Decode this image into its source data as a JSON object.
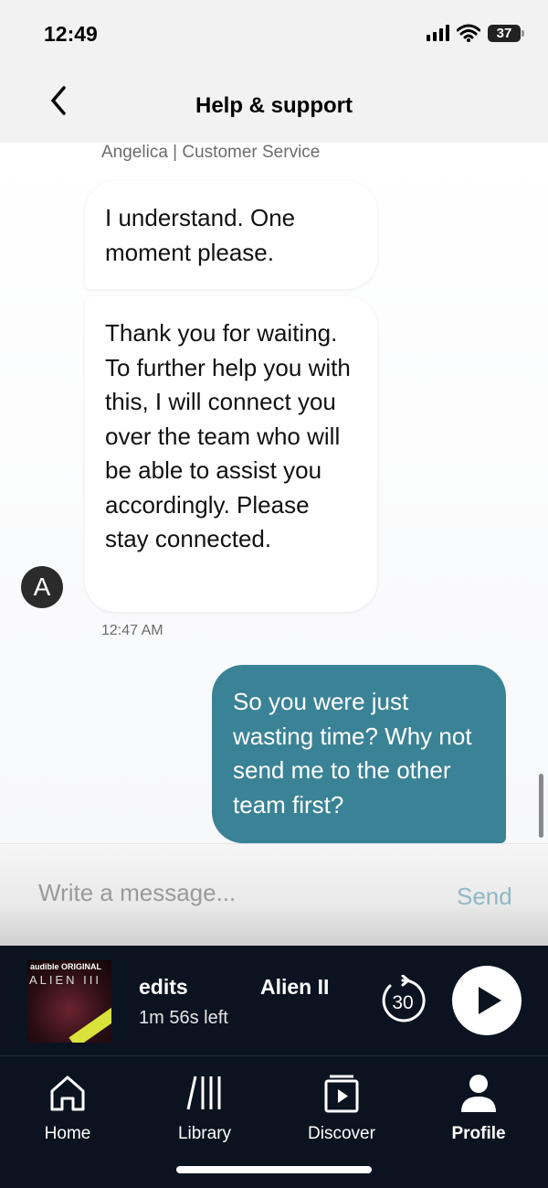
{
  "status_bar": {
    "time": "12:49",
    "battery": "37"
  },
  "header": {
    "title": "Help & support"
  },
  "chat": {
    "agent_name": "Angelica | Customer Service",
    "avatar_initial": "A",
    "messages": [
      {
        "from": "agent",
        "text": "I understand. One moment please."
      },
      {
        "from": "agent",
        "text": "Thank you for waiting. To further help you with this, I will connect you over the team who will be able to assist you accordingly. Please stay connected."
      },
      {
        "from": "user",
        "text": "So you were just wasting time? Why not send me to the other team first?"
      }
    ],
    "timestamp": "12:47 AM"
  },
  "composer": {
    "placeholder": "Write a message...",
    "send_label": "Send"
  },
  "player": {
    "cover_brand": "audible ORIGINAL",
    "cover_title": "ALIEN III",
    "title_fragment_1": "edits",
    "title_fragment_2": "Alien II",
    "time_left": "1m 56s left",
    "skip_seconds": "30"
  },
  "tabs": [
    {
      "label": "Home",
      "icon": "home-icon"
    },
    {
      "label": "Library",
      "icon": "library-icon"
    },
    {
      "label": "Discover",
      "icon": "discover-icon"
    },
    {
      "label": "Profile",
      "icon": "profile-icon",
      "active": true
    }
  ],
  "colors": {
    "user_bubble": "#3a8296",
    "send": "#8fb8c6",
    "nav_bg": "#0b1320"
  }
}
